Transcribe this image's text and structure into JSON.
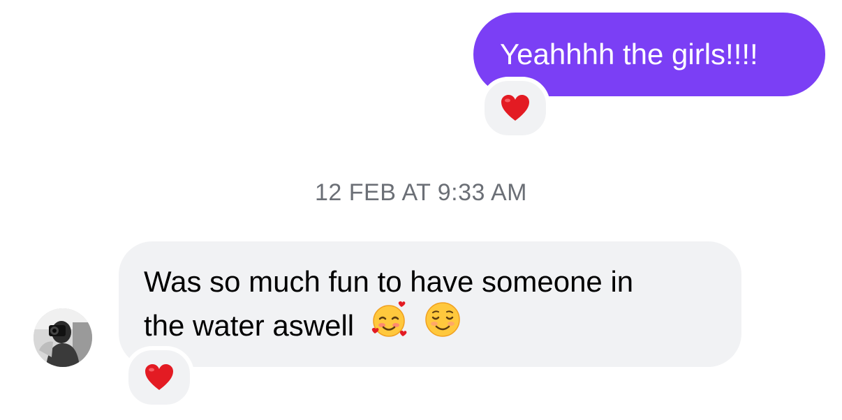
{
  "outgoing_message": {
    "text": "Yeahhhh the girls!!!!",
    "bubble_color": "#7b3ff5",
    "reaction": "red-heart-icon"
  },
  "timestamp": "12 FEB AT 9:33 AM",
  "incoming_message": {
    "line1": "Was so much fun to have someone in",
    "line2": "the water aswell",
    "emojis": [
      "smiling-face-with-hearts-icon",
      "smiling-face-icon"
    ],
    "reaction": "red-heart-icon",
    "bubble_color": "#f1f2f4"
  },
  "sender": {
    "avatar": "avatar"
  }
}
